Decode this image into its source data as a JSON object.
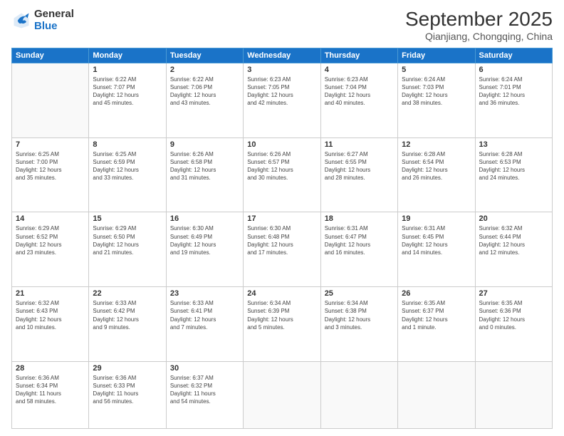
{
  "logo": {
    "general": "General",
    "blue": "Blue"
  },
  "header": {
    "month": "September 2025",
    "location": "Qianjiang, Chongqing, China"
  },
  "weekdays": [
    "Sunday",
    "Monday",
    "Tuesday",
    "Wednesday",
    "Thursday",
    "Friday",
    "Saturday"
  ],
  "weeks": [
    [
      {
        "day": "",
        "info": ""
      },
      {
        "day": "1",
        "info": "Sunrise: 6:22 AM\nSunset: 7:07 PM\nDaylight: 12 hours\nand 45 minutes."
      },
      {
        "day": "2",
        "info": "Sunrise: 6:22 AM\nSunset: 7:06 PM\nDaylight: 12 hours\nand 43 minutes."
      },
      {
        "day": "3",
        "info": "Sunrise: 6:23 AM\nSunset: 7:05 PM\nDaylight: 12 hours\nand 42 minutes."
      },
      {
        "day": "4",
        "info": "Sunrise: 6:23 AM\nSunset: 7:04 PM\nDaylight: 12 hours\nand 40 minutes."
      },
      {
        "day": "5",
        "info": "Sunrise: 6:24 AM\nSunset: 7:03 PM\nDaylight: 12 hours\nand 38 minutes."
      },
      {
        "day": "6",
        "info": "Sunrise: 6:24 AM\nSunset: 7:01 PM\nDaylight: 12 hours\nand 36 minutes."
      }
    ],
    [
      {
        "day": "7",
        "info": "Sunrise: 6:25 AM\nSunset: 7:00 PM\nDaylight: 12 hours\nand 35 minutes."
      },
      {
        "day": "8",
        "info": "Sunrise: 6:25 AM\nSunset: 6:59 PM\nDaylight: 12 hours\nand 33 minutes."
      },
      {
        "day": "9",
        "info": "Sunrise: 6:26 AM\nSunset: 6:58 PM\nDaylight: 12 hours\nand 31 minutes."
      },
      {
        "day": "10",
        "info": "Sunrise: 6:26 AM\nSunset: 6:57 PM\nDaylight: 12 hours\nand 30 minutes."
      },
      {
        "day": "11",
        "info": "Sunrise: 6:27 AM\nSunset: 6:55 PM\nDaylight: 12 hours\nand 28 minutes."
      },
      {
        "day": "12",
        "info": "Sunrise: 6:28 AM\nSunset: 6:54 PM\nDaylight: 12 hours\nand 26 minutes."
      },
      {
        "day": "13",
        "info": "Sunrise: 6:28 AM\nSunset: 6:53 PM\nDaylight: 12 hours\nand 24 minutes."
      }
    ],
    [
      {
        "day": "14",
        "info": "Sunrise: 6:29 AM\nSunset: 6:52 PM\nDaylight: 12 hours\nand 23 minutes."
      },
      {
        "day": "15",
        "info": "Sunrise: 6:29 AM\nSunset: 6:50 PM\nDaylight: 12 hours\nand 21 minutes."
      },
      {
        "day": "16",
        "info": "Sunrise: 6:30 AM\nSunset: 6:49 PM\nDaylight: 12 hours\nand 19 minutes."
      },
      {
        "day": "17",
        "info": "Sunrise: 6:30 AM\nSunset: 6:48 PM\nDaylight: 12 hours\nand 17 minutes."
      },
      {
        "day": "18",
        "info": "Sunrise: 6:31 AM\nSunset: 6:47 PM\nDaylight: 12 hours\nand 16 minutes."
      },
      {
        "day": "19",
        "info": "Sunrise: 6:31 AM\nSunset: 6:45 PM\nDaylight: 12 hours\nand 14 minutes."
      },
      {
        "day": "20",
        "info": "Sunrise: 6:32 AM\nSunset: 6:44 PM\nDaylight: 12 hours\nand 12 minutes."
      }
    ],
    [
      {
        "day": "21",
        "info": "Sunrise: 6:32 AM\nSunset: 6:43 PM\nDaylight: 12 hours\nand 10 minutes."
      },
      {
        "day": "22",
        "info": "Sunrise: 6:33 AM\nSunset: 6:42 PM\nDaylight: 12 hours\nand 9 minutes."
      },
      {
        "day": "23",
        "info": "Sunrise: 6:33 AM\nSunset: 6:41 PM\nDaylight: 12 hours\nand 7 minutes."
      },
      {
        "day": "24",
        "info": "Sunrise: 6:34 AM\nSunset: 6:39 PM\nDaylight: 12 hours\nand 5 minutes."
      },
      {
        "day": "25",
        "info": "Sunrise: 6:34 AM\nSunset: 6:38 PM\nDaylight: 12 hours\nand 3 minutes."
      },
      {
        "day": "26",
        "info": "Sunrise: 6:35 AM\nSunset: 6:37 PM\nDaylight: 12 hours\nand 1 minute."
      },
      {
        "day": "27",
        "info": "Sunrise: 6:35 AM\nSunset: 6:36 PM\nDaylight: 12 hours\nand 0 minutes."
      }
    ],
    [
      {
        "day": "28",
        "info": "Sunrise: 6:36 AM\nSunset: 6:34 PM\nDaylight: 11 hours\nand 58 minutes."
      },
      {
        "day": "29",
        "info": "Sunrise: 6:36 AM\nSunset: 6:33 PM\nDaylight: 11 hours\nand 56 minutes."
      },
      {
        "day": "30",
        "info": "Sunrise: 6:37 AM\nSunset: 6:32 PM\nDaylight: 11 hours\nand 54 minutes."
      },
      {
        "day": "",
        "info": ""
      },
      {
        "day": "",
        "info": ""
      },
      {
        "day": "",
        "info": ""
      },
      {
        "day": "",
        "info": ""
      }
    ]
  ]
}
